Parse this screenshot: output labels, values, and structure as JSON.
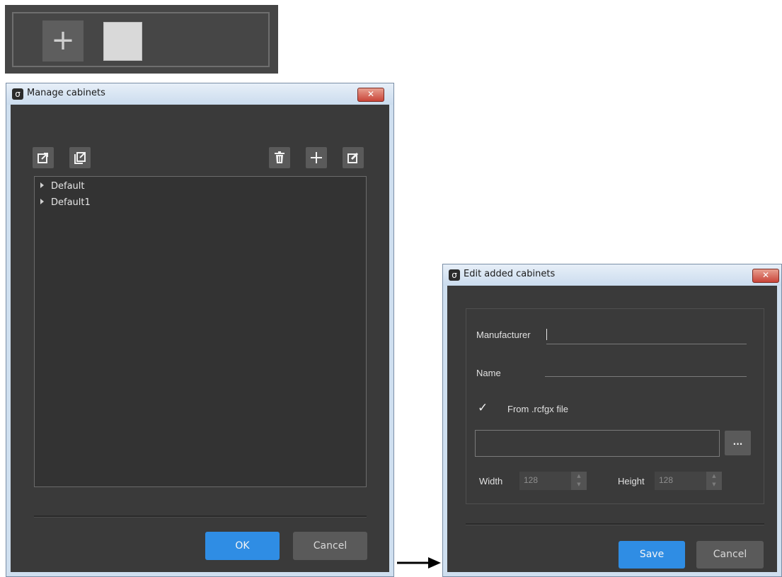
{
  "top_strip": {
    "add_symbol": "+"
  },
  "manage_window": {
    "title": "Manage cabinets",
    "close_symbol": "✕",
    "toolbar_icons": [
      "export-icon",
      "copy-export-icon",
      "trash-icon",
      "plus-icon",
      "edit-icon"
    ],
    "tree_items": [
      {
        "label": "Default"
      },
      {
        "label": "Default1"
      }
    ],
    "ok_label": "OK",
    "cancel_label": "Cancel"
  },
  "edit_window": {
    "title": "Edit added cabinets",
    "close_symbol": "✕",
    "manufacturer_label": "Manufacturer",
    "manufacturer_value": "",
    "name_label": "Name",
    "name_value": "",
    "from_file_checked": true,
    "check_mark": "✓",
    "from_file_label": "From .rcfgx file",
    "file_path_value": "",
    "browse_label": "...",
    "width_label": "Width",
    "width_value": "128",
    "height_label": "Height",
    "height_value": "128",
    "save_label": "Save",
    "cancel_label": "Cancel"
  },
  "colors": {
    "dialog_bg": "#3a3a3a",
    "primary_button": "#2f8de4",
    "secondary_button": "#5a5a5a",
    "title_bar": "#cbdcee",
    "close_button": "#c9463a"
  }
}
